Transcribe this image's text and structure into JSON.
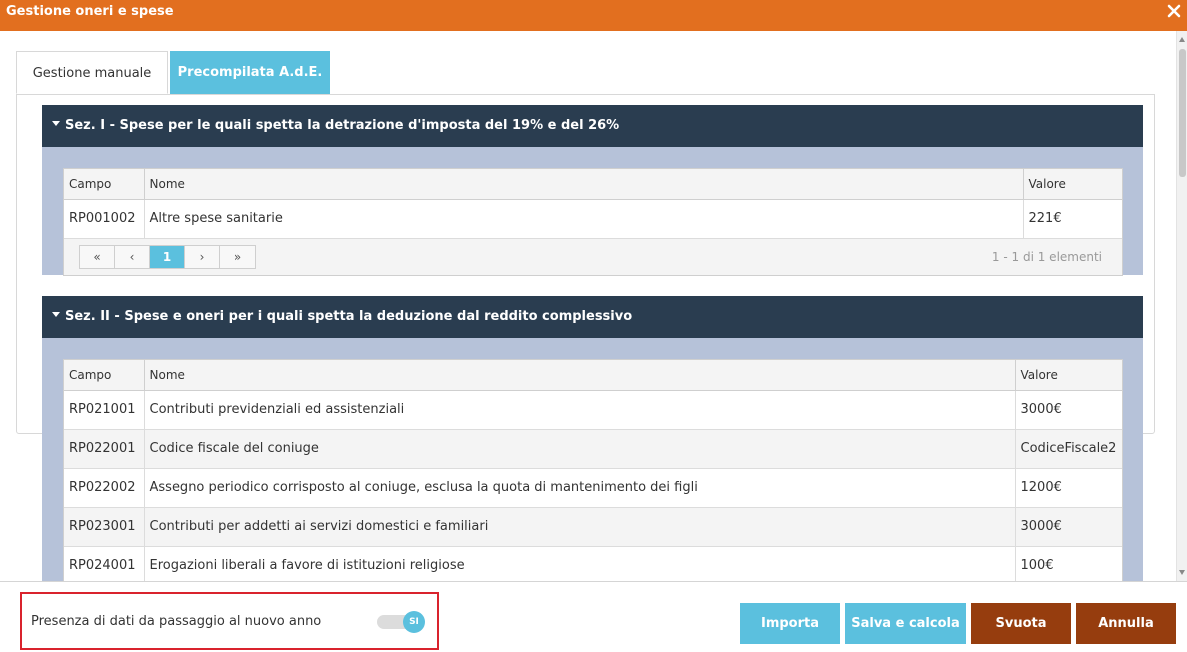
{
  "window": {
    "title": "Gestione oneri e spese"
  },
  "tabs": [
    {
      "label": "Gestione manuale"
    },
    {
      "label": "Precompilata A.d.E."
    }
  ],
  "sections": [
    {
      "title": "Sez. I - Spese per le quali spetta la detrazione d'imposta del 19% e del 26%",
      "columns": [
        "Campo",
        "Nome",
        "Valore"
      ],
      "rows": [
        {
          "campo": "RP001002",
          "nome": "Altre spese sanitarie",
          "valore": "221€"
        }
      ],
      "pager": {
        "first": "«",
        "prev": "‹",
        "page": "1",
        "next": "›",
        "last": "»",
        "info": "1 - 1 di 1 elementi"
      }
    },
    {
      "title": "Sez. II - Spese e oneri per i quali spetta la deduzione dal reddito complessivo",
      "columns": [
        "Campo",
        "Nome",
        "Valore"
      ],
      "rows": [
        {
          "campo": "RP021001",
          "nome": "Contributi previdenziali ed assistenziali",
          "valore": "3000€"
        },
        {
          "campo": "RP022001",
          "nome": "Codice fiscale del coniuge",
          "valore": "CodiceFiscale2"
        },
        {
          "campo": "RP022002",
          "nome": "Assegno periodico corrisposto al coniuge, esclusa la quota di mantenimento dei figli",
          "valore": "1200€"
        },
        {
          "campo": "RP023001",
          "nome": "Contributi per addetti ai servizi domestici e familiari",
          "valore": "3000€"
        },
        {
          "campo": "RP024001",
          "nome": "Erogazioni liberali a favore di istituzioni religiose",
          "valore": "100€"
        }
      ]
    }
  ],
  "footer": {
    "toggle_label": "Presenza di dati da passaggio al nuovo anno",
    "toggle_value": "SI",
    "buttons": {
      "importa": "Importa",
      "salva": "Salva e calcola",
      "svuota": "Svuota",
      "annulla": "Annulla"
    }
  },
  "colors": {
    "titlebar": "#e26f1f",
    "section_header": "#2a3d50",
    "section_body": "#b6c2d9",
    "accent": "#5bc0de",
    "danger_button": "#963d0e",
    "highlight_border": "#d9232d"
  }
}
